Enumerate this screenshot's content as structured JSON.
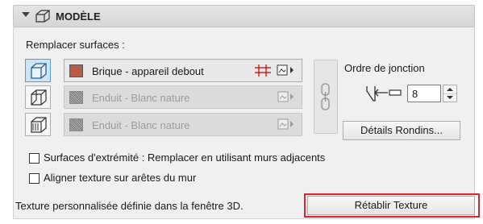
{
  "section": {
    "title": "MODÈLE",
    "collapse_icon": "chevron-down-icon",
    "section_icon": "wall-model-icon"
  },
  "surfaces": {
    "label": "Remplacer surfaces :",
    "rows": [
      {
        "name": "Brique - appareil debout",
        "swatch": "brick",
        "swatch_color": "#b85a45",
        "active": true,
        "icon": "wall-outside-face-icon"
      },
      {
        "name": "Enduit - Blanc nature",
        "swatch": "hatch",
        "active": false,
        "icon": "wall-inside-face-icon"
      },
      {
        "name": "Enduit - Blanc nature",
        "swatch": "hatch",
        "active": false,
        "icon": "wall-edge-face-icon"
      }
    ],
    "link_icon": "chain-link-icon"
  },
  "junction": {
    "label": "Ordre de jonction",
    "value": "8",
    "icon": "junction-order-icon"
  },
  "details_button": "Détails Rondins...",
  "checkboxes": [
    {
      "label": "Surfaces d'extrémité : Remplacer en utilisant murs adjacents",
      "checked": false
    },
    {
      "label": "Aligner texture sur arêtes du mur",
      "checked": false
    }
  ],
  "footer": {
    "info": "Texture personnalisée définie dans la fenêtre 3D.",
    "reset_button": "Rétablir Texture",
    "highlight_color": "#e0242b"
  }
}
